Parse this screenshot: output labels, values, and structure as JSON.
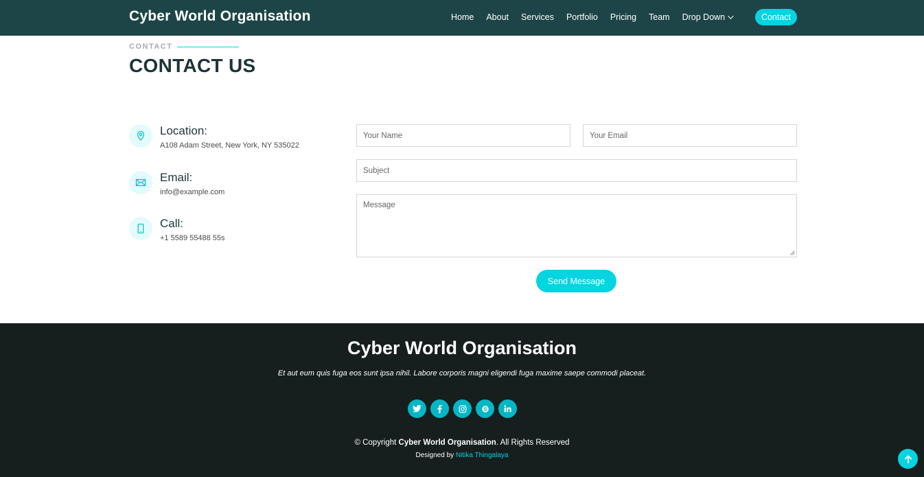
{
  "header": {
    "brand": "Cyber World Organisation",
    "nav": [
      "Home",
      "About",
      "Services",
      "Portfolio",
      "Pricing",
      "Team",
      "Drop Down"
    ],
    "cta": "Contact"
  },
  "section": {
    "eyebrow": "CONTACT",
    "title": "CONTACT US"
  },
  "info": [
    {
      "icon": "map-pin-icon",
      "title": "Location:",
      "text": "A108 Adam Street, New York, NY 535022"
    },
    {
      "icon": "envelope-icon",
      "title": "Email:",
      "text": "info@example.com"
    },
    {
      "icon": "phone-icon",
      "title": "Call:",
      "text": "+1 5589 55488 55s"
    }
  ],
  "form": {
    "name_placeholder": "Your Name",
    "email_placeholder": "Your Email",
    "subject_placeholder": "Subject",
    "message_placeholder": "Message",
    "submit_label": "Send Message"
  },
  "footer": {
    "title": "Cyber World Organisation",
    "text": "Et aut eum quis fuga eos sunt ipsa nihil. Labore corporis magni eligendi fuga maxime saepe commodi placeat.",
    "socials": [
      "twitter-icon",
      "facebook-icon",
      "instagram-icon",
      "skype-icon",
      "linkedin-icon"
    ],
    "copyright_prefix": "© Copyright",
    "copyright_brand": "Cyber World Organisation",
    "copyright_suffix": ". All Rights Reserved",
    "designed_by": "Designed by",
    "designer": "Nitika Thingalaya"
  },
  "colors": {
    "header_bg": "#1d4547",
    "accent": "#06d4e0",
    "footer_bg": "#161e1e"
  }
}
